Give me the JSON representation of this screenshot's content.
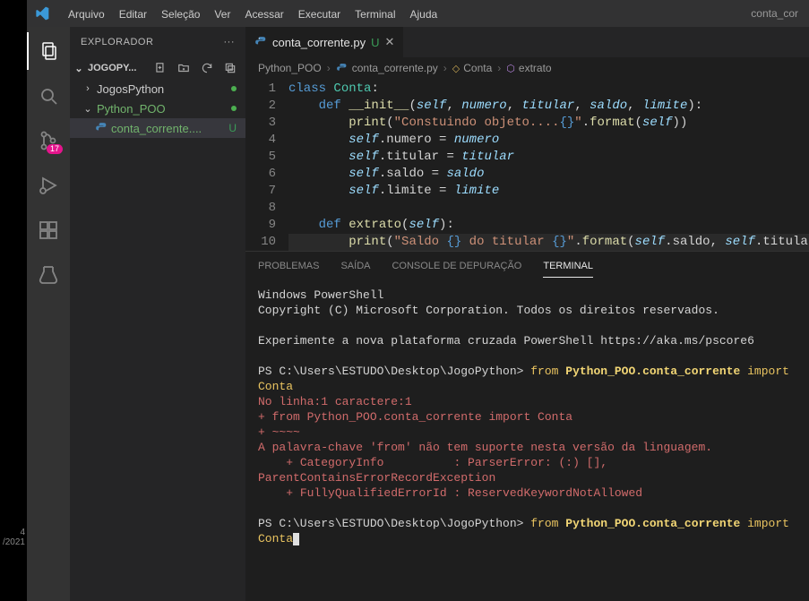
{
  "left_strip": {
    "line1": "4",
    "line2": "/2021"
  },
  "titlebar": {
    "menu": [
      "Arquivo",
      "Editar",
      "Seleção",
      "Ver",
      "Acessar",
      "Executar",
      "Terminal",
      "Ajuda"
    ],
    "filename": "conta_cor"
  },
  "activity": {
    "scm_badge": "17"
  },
  "sidebar": {
    "title": "EXPLORADOR",
    "workspace": "JOGOPY...",
    "tree": [
      {
        "type": "folder",
        "label": "JogosPython",
        "expanded": false,
        "mod": true,
        "green": false
      },
      {
        "type": "folder",
        "label": "Python_POO",
        "expanded": true,
        "mod": true,
        "green": true
      },
      {
        "type": "file",
        "label": "conta_corrente....",
        "badge": "U",
        "selected": true
      }
    ]
  },
  "tab": {
    "filename": "conta_corrente.py",
    "badge": "U"
  },
  "breadcrumbs": {
    "items": [
      "Python_POO",
      "conta_corrente.py",
      "Conta",
      "extrato"
    ]
  },
  "code": {
    "lines": [
      {
        "n": 1,
        "segments": [
          [
            "kw",
            "class "
          ],
          [
            "cls-name",
            "Conta"
          ],
          [
            "pun",
            ":"
          ]
        ]
      },
      {
        "n": 2,
        "segments": [
          [
            "",
            "    "
          ],
          [
            "kw",
            "def "
          ],
          [
            "fn-def",
            "__init__"
          ],
          [
            "pun",
            "("
          ],
          [
            "slf",
            "self"
          ],
          [
            "pun",
            ", "
          ],
          [
            "param",
            "numero"
          ],
          [
            "pun",
            ", "
          ],
          [
            "param",
            "titular"
          ],
          [
            "pun",
            ", "
          ],
          [
            "param",
            "saldo"
          ],
          [
            "pun",
            ", "
          ],
          [
            "param",
            "limite"
          ],
          [
            "pun",
            "):"
          ]
        ]
      },
      {
        "n": 3,
        "segments": [
          [
            "",
            "        "
          ],
          [
            "method",
            "print"
          ],
          [
            "pun",
            "("
          ],
          [
            "str",
            "\"Constuindo objeto...."
          ],
          [
            "escseq",
            "{}"
          ],
          [
            "str",
            "\""
          ],
          [
            "pun",
            "."
          ],
          [
            "method",
            "format"
          ],
          [
            "pun",
            "("
          ],
          [
            "slf",
            "self"
          ],
          [
            "pun",
            "))"
          ]
        ]
      },
      {
        "n": 4,
        "segments": [
          [
            "",
            "        "
          ],
          [
            "slf",
            "self"
          ],
          [
            "pun",
            "."
          ],
          [
            "",
            "numero "
          ],
          [
            "op",
            "= "
          ],
          [
            "param",
            "numero"
          ]
        ]
      },
      {
        "n": 5,
        "segments": [
          [
            "",
            "        "
          ],
          [
            "slf",
            "self"
          ],
          [
            "pun",
            "."
          ],
          [
            "",
            "titular "
          ],
          [
            "op",
            "= "
          ],
          [
            "param",
            "titular"
          ]
        ]
      },
      {
        "n": 6,
        "segments": [
          [
            "",
            "        "
          ],
          [
            "slf",
            "self"
          ],
          [
            "pun",
            "."
          ],
          [
            "",
            "saldo "
          ],
          [
            "op",
            "= "
          ],
          [
            "param",
            "saldo"
          ]
        ]
      },
      {
        "n": 7,
        "segments": [
          [
            "",
            "        "
          ],
          [
            "slf",
            "self"
          ],
          [
            "pun",
            "."
          ],
          [
            "",
            "limite "
          ],
          [
            "op",
            "= "
          ],
          [
            "param",
            "limite"
          ]
        ]
      },
      {
        "n": 8,
        "segments": [
          [
            "",
            ""
          ]
        ]
      },
      {
        "n": 9,
        "segments": [
          [
            "",
            "    "
          ],
          [
            "kw",
            "def "
          ],
          [
            "fn-def",
            "extrato"
          ],
          [
            "pun",
            "("
          ],
          [
            "slf",
            "self"
          ],
          [
            "pun",
            "):"
          ]
        ]
      },
      {
        "n": 10,
        "current": true,
        "segments": [
          [
            "",
            "        "
          ],
          [
            "method",
            "print"
          ],
          [
            "pun",
            "("
          ],
          [
            "str",
            "\"Saldo "
          ],
          [
            "escseq",
            "{}"
          ],
          [
            "str",
            " do titular "
          ],
          [
            "escseq",
            "{}"
          ],
          [
            "str",
            "\""
          ],
          [
            "pun",
            "."
          ],
          [
            "method",
            "format"
          ],
          [
            "pun",
            "("
          ],
          [
            "slf",
            "self"
          ],
          [
            "pun",
            "."
          ],
          [
            "",
            "saldo"
          ],
          [
            "pun",
            ", "
          ],
          [
            "slf",
            "self"
          ],
          [
            "pun",
            "."
          ],
          [
            "",
            "titular"
          ],
          [
            "pun",
            "))"
          ]
        ]
      }
    ]
  },
  "panel": {
    "tabs": [
      "PROBLEMAS",
      "SAÍDA",
      "CONSOLE DE DEPURAÇÃO",
      "TERMINAL"
    ],
    "active": 3
  },
  "terminal": {
    "lines": [
      {
        "cls": "",
        "text": "Windows PowerShell"
      },
      {
        "cls": "",
        "text": "Copyright (C) Microsoft Corporation. Todos os direitos reservados."
      },
      {
        "cls": "",
        "text": ""
      },
      {
        "cls": "",
        "text": "Experimente a nova plataforma cruzada PowerShell https://aka.ms/pscore6"
      },
      {
        "cls": "",
        "text": ""
      }
    ],
    "prompt_path": "PS C:\\Users\\ESTUDO\\Desktop\\JogoPython> ",
    "cmd_from": "from ",
    "cmd_mod": "Python_POO.conta_corrente ",
    "cmd_import": "import ",
    "cmd_cls": "Conta",
    "error": [
      "No linha:1 caractere:1",
      "+ from Python_POO.conta_corrente import Conta",
      "+ ~~~~",
      "A palavra-chave 'from' não tem suporte nesta versão da linguagem.",
      "    + CategoryInfo          : ParserError: (:) [], ParentContainsErrorRecordException",
      "    + FullyQualifiedErrorId : ReservedKeywordNotAllowed"
    ]
  }
}
